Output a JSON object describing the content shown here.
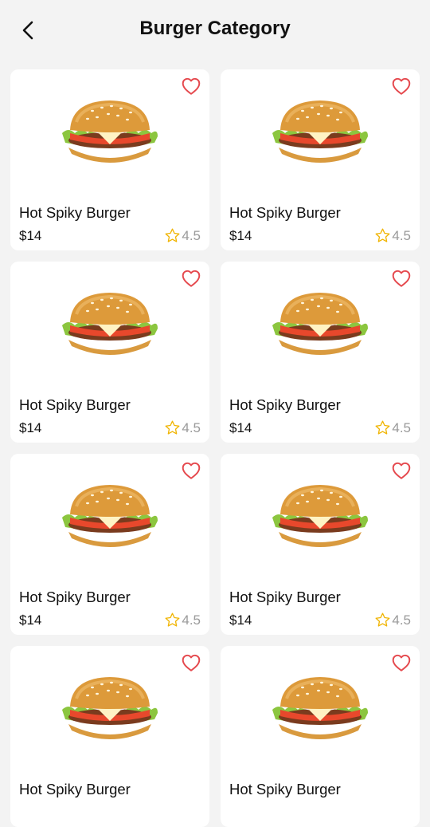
{
  "header": {
    "title": "Burger Category",
    "back_icon": "back-arrow-icon"
  },
  "products": [
    {
      "name": "Hot Spiky Burger",
      "price": "$14",
      "rating": "4.5"
    },
    {
      "name": "Hot Spiky Burger",
      "price": "$14",
      "rating": "4.5"
    },
    {
      "name": "Hot Spiky Burger",
      "price": "$14",
      "rating": "4.5"
    },
    {
      "name": "Hot Spiky Burger",
      "price": "$14",
      "rating": "4.5"
    },
    {
      "name": "Hot Spiky Burger",
      "price": "$14",
      "rating": "4.5"
    },
    {
      "name": "Hot Spiky Burger",
      "price": "$14",
      "rating": "4.5"
    },
    {
      "name": "Hot Spiky Burger",
      "price": "",
      "rating": ""
    },
    {
      "name": "Hot Spiky Burger",
      "price": "",
      "rating": ""
    }
  ],
  "colors": {
    "heart": "#e5484d",
    "star": "#f0b400",
    "background": "#f3f3f3"
  }
}
